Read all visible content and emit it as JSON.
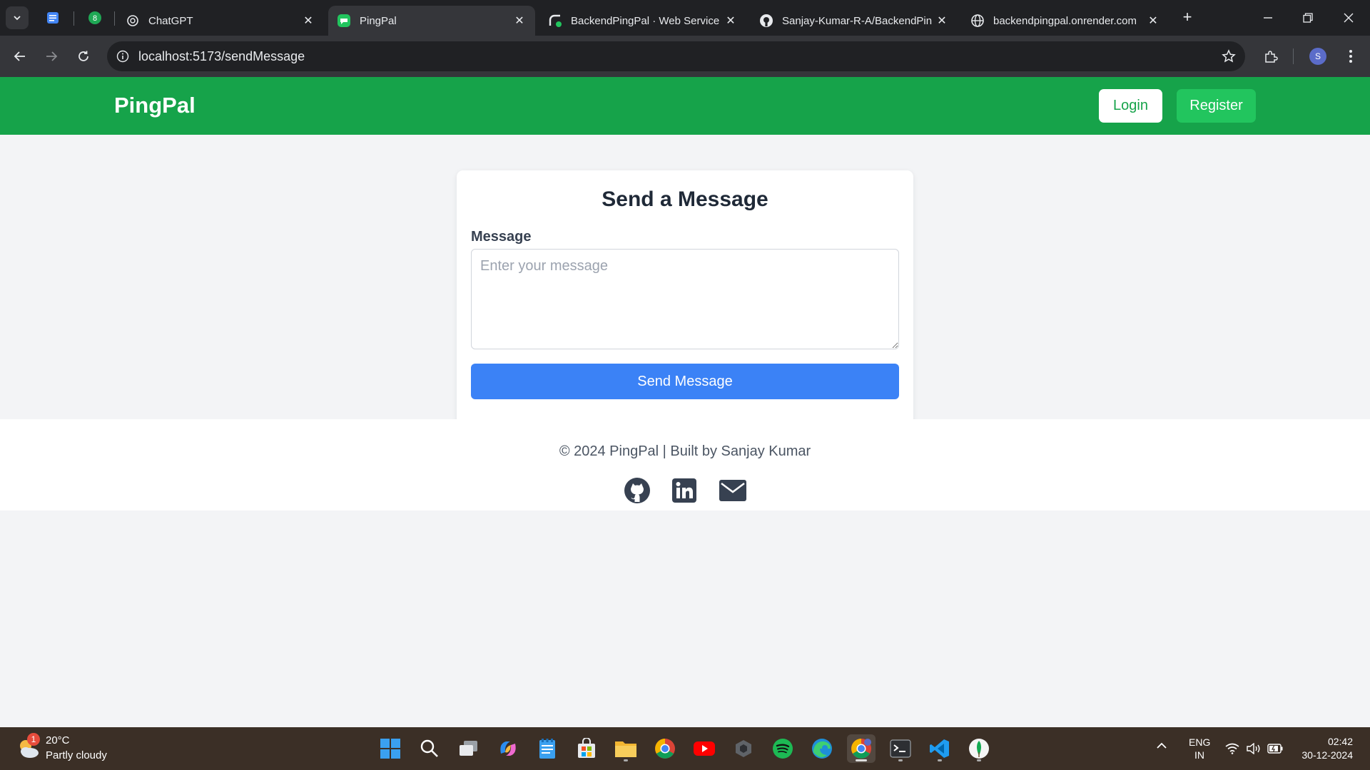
{
  "browser": {
    "pinned_badge": "8",
    "tabs": [
      {
        "title": "ChatGPT"
      },
      {
        "title": "PingPal"
      },
      {
        "title": "BackendPingPal · Web Service"
      },
      {
        "title": "Sanjay-Kumar-R-A/BackendPin"
      },
      {
        "title": "backendpingpal.onrender.com"
      }
    ],
    "url": "localhost:5173/sendMessage",
    "profile_initial": "S"
  },
  "app": {
    "brand": "PingPal",
    "login_label": "Login",
    "register_label": "Register",
    "colors": {
      "header": "#16a34a",
      "primary": "#3b82f6"
    }
  },
  "form": {
    "title": "Send a Message",
    "message_label": "Message",
    "message_placeholder": "Enter your message",
    "message_value": "",
    "submit_label": "Send Message"
  },
  "footer": {
    "text": "© 2024 PingPal | Built by Sanjay Kumar",
    "social_icons": [
      "github-icon",
      "linkedin-icon",
      "mail-icon"
    ]
  },
  "taskbar": {
    "weather_temp": "20°C",
    "weather_desc": "Partly cloudy",
    "weather_badge": "1",
    "lang_line1": "ENG",
    "lang_line2": "IN",
    "time": "02:42",
    "date": "30-12-2024"
  }
}
